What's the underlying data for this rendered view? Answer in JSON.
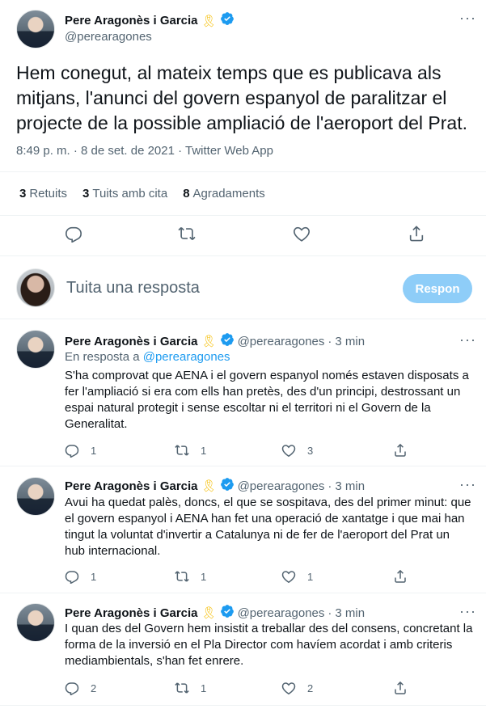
{
  "tweet": {
    "name": "Pere Aragonès i Garcia",
    "handle": "@perearagones",
    "text": "Hem conegut, al mateix temps que es publicava als mitjans, l'anunci del govern espanyol de paralitzar el projecte de la possible ampliació de l'aeroport del Prat.",
    "meta": "8:49 p. m. · 8 de set. de 2021 · Twitter Web App",
    "stats": {
      "retweets_count": "3",
      "retweets_label": "Retuits",
      "quotes_count": "3",
      "quotes_label": "Tuits amb cita",
      "likes_count": "8",
      "likes_label": "Agradaments"
    }
  },
  "composer": {
    "placeholder": "Tuita una resposta",
    "button": "Respon"
  },
  "replies": [
    {
      "name": "Pere Aragonès i Garcia",
      "handle": "@perearagones",
      "time": "3 min",
      "in_reply_label": "En resposta a",
      "in_reply_handle": "@perearagones",
      "text": "S'ha comprovat que AENA i el govern espanyol només estaven disposats a fer l'ampliació si era com ells han pretès, des d'un principi, destrossant un espai natural protegit i sense escoltar ni el territori ni el Govern de la Generalitat.",
      "replies": "1",
      "retweets": "1",
      "likes": "3"
    },
    {
      "name": "Pere Aragonès i Garcia",
      "handle": "@perearagones",
      "time": "3 min",
      "text": "Avui ha quedat palès, doncs, el que se sospitava, des del primer minut: que el govern espanyol i AENA han fet una operació de xantatge i que mai han tingut la voluntat d'invertir a Catalunya ni de fer de l'aeroport del Prat un hub internacional.",
      "replies": "1",
      "retweets": "1",
      "likes": "1"
    },
    {
      "name": "Pere Aragonès i Garcia",
      "handle": "@perearagones",
      "time": "3 min",
      "text": "I quan des del Govern hem insistit a treballar des del consens, concretant la forma de la inversió en el Pla Director com havíem acordat i amb criteris mediambientals, s'han fet enrere.",
      "replies": "2",
      "retweets": "1",
      "likes": "2"
    }
  ],
  "icons": {
    "ribbon": "yellow-ribbon-icon",
    "verified": "verified-badge-icon",
    "more": "more-icon",
    "reply": "reply-icon",
    "retweet": "retweet-icon",
    "like": "heart-icon",
    "share": "share-icon"
  },
  "colors": {
    "accent": "#1d9bf0",
    "ribbon": "#f6c213",
    "button_disabled": "#8ecdf8",
    "muted": "#536471"
  }
}
